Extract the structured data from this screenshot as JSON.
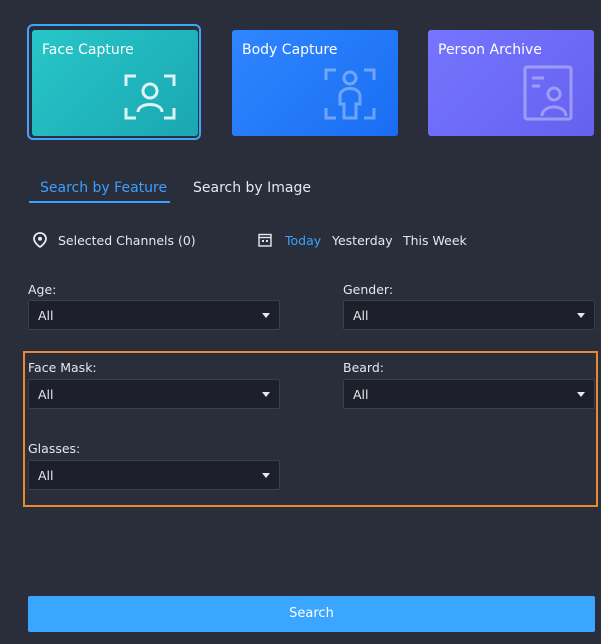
{
  "cards": [
    {
      "label": "Face Capture",
      "icon": "face-scan-icon",
      "color": "#1ab1b8"
    },
    {
      "label": "Body Capture",
      "icon": "body-scan-icon",
      "color": "#2479f7"
    },
    {
      "label": "Person Archive",
      "icon": "person-archive-icon",
      "color": "#6d69f6"
    }
  ],
  "tabs": {
    "feature": "Search by Feature",
    "image": "Search by Image"
  },
  "filters": {
    "channels": "Selected Channels (0)",
    "dates": {
      "today": "Today",
      "yesterday": "Yesterday",
      "week": "This Week"
    }
  },
  "fields": {
    "age": {
      "label": "Age:",
      "value": "All"
    },
    "gender": {
      "label": "Gender:",
      "value": "All"
    },
    "mask": {
      "label": "Face Mask:",
      "value": "All"
    },
    "beard": {
      "label": "Beard:",
      "value": "All"
    },
    "glasses": {
      "label": "Glasses:",
      "value": "All"
    }
  },
  "search_label": "Search",
  "colors": {
    "accent": "#3ba0ff",
    "highlight": "#e8892f",
    "panel": "#2a2d3a"
  }
}
